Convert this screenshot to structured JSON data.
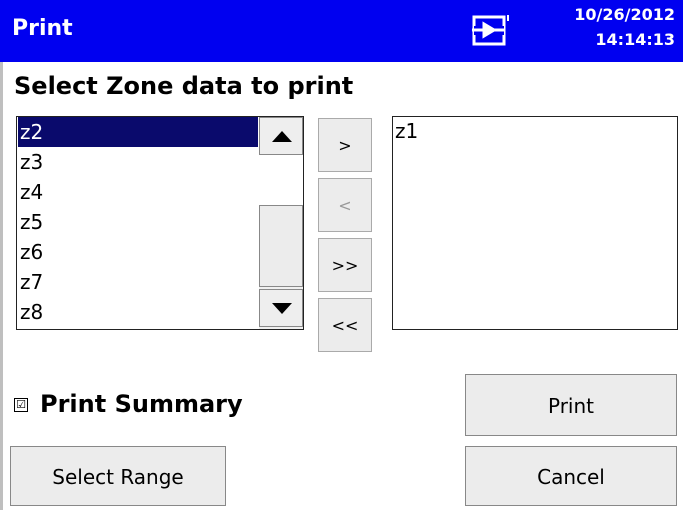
{
  "titlebar": {
    "title": "Print",
    "date": "10/26/2012",
    "time": "14:14:13",
    "icon": "plug-icon",
    "color": "#0000f0"
  },
  "heading": "Select Zone data to print",
  "zone_list": {
    "items": [
      "z2",
      "z3",
      "z4",
      "z5",
      "z6",
      "z7",
      "z8"
    ],
    "selected": "z2",
    "selection_color": "#0a0a6c"
  },
  "transfer": {
    "add": ">",
    "remove": "<",
    "add_all": ">>",
    "remove_all": "<<"
  },
  "selected_list": {
    "items": [
      "z1"
    ]
  },
  "summary": {
    "checked": true,
    "mark": "☑",
    "label": "Print Summary"
  },
  "buttons": {
    "print": "Print",
    "cancel": "Cancel",
    "select_range": "Select Range"
  }
}
